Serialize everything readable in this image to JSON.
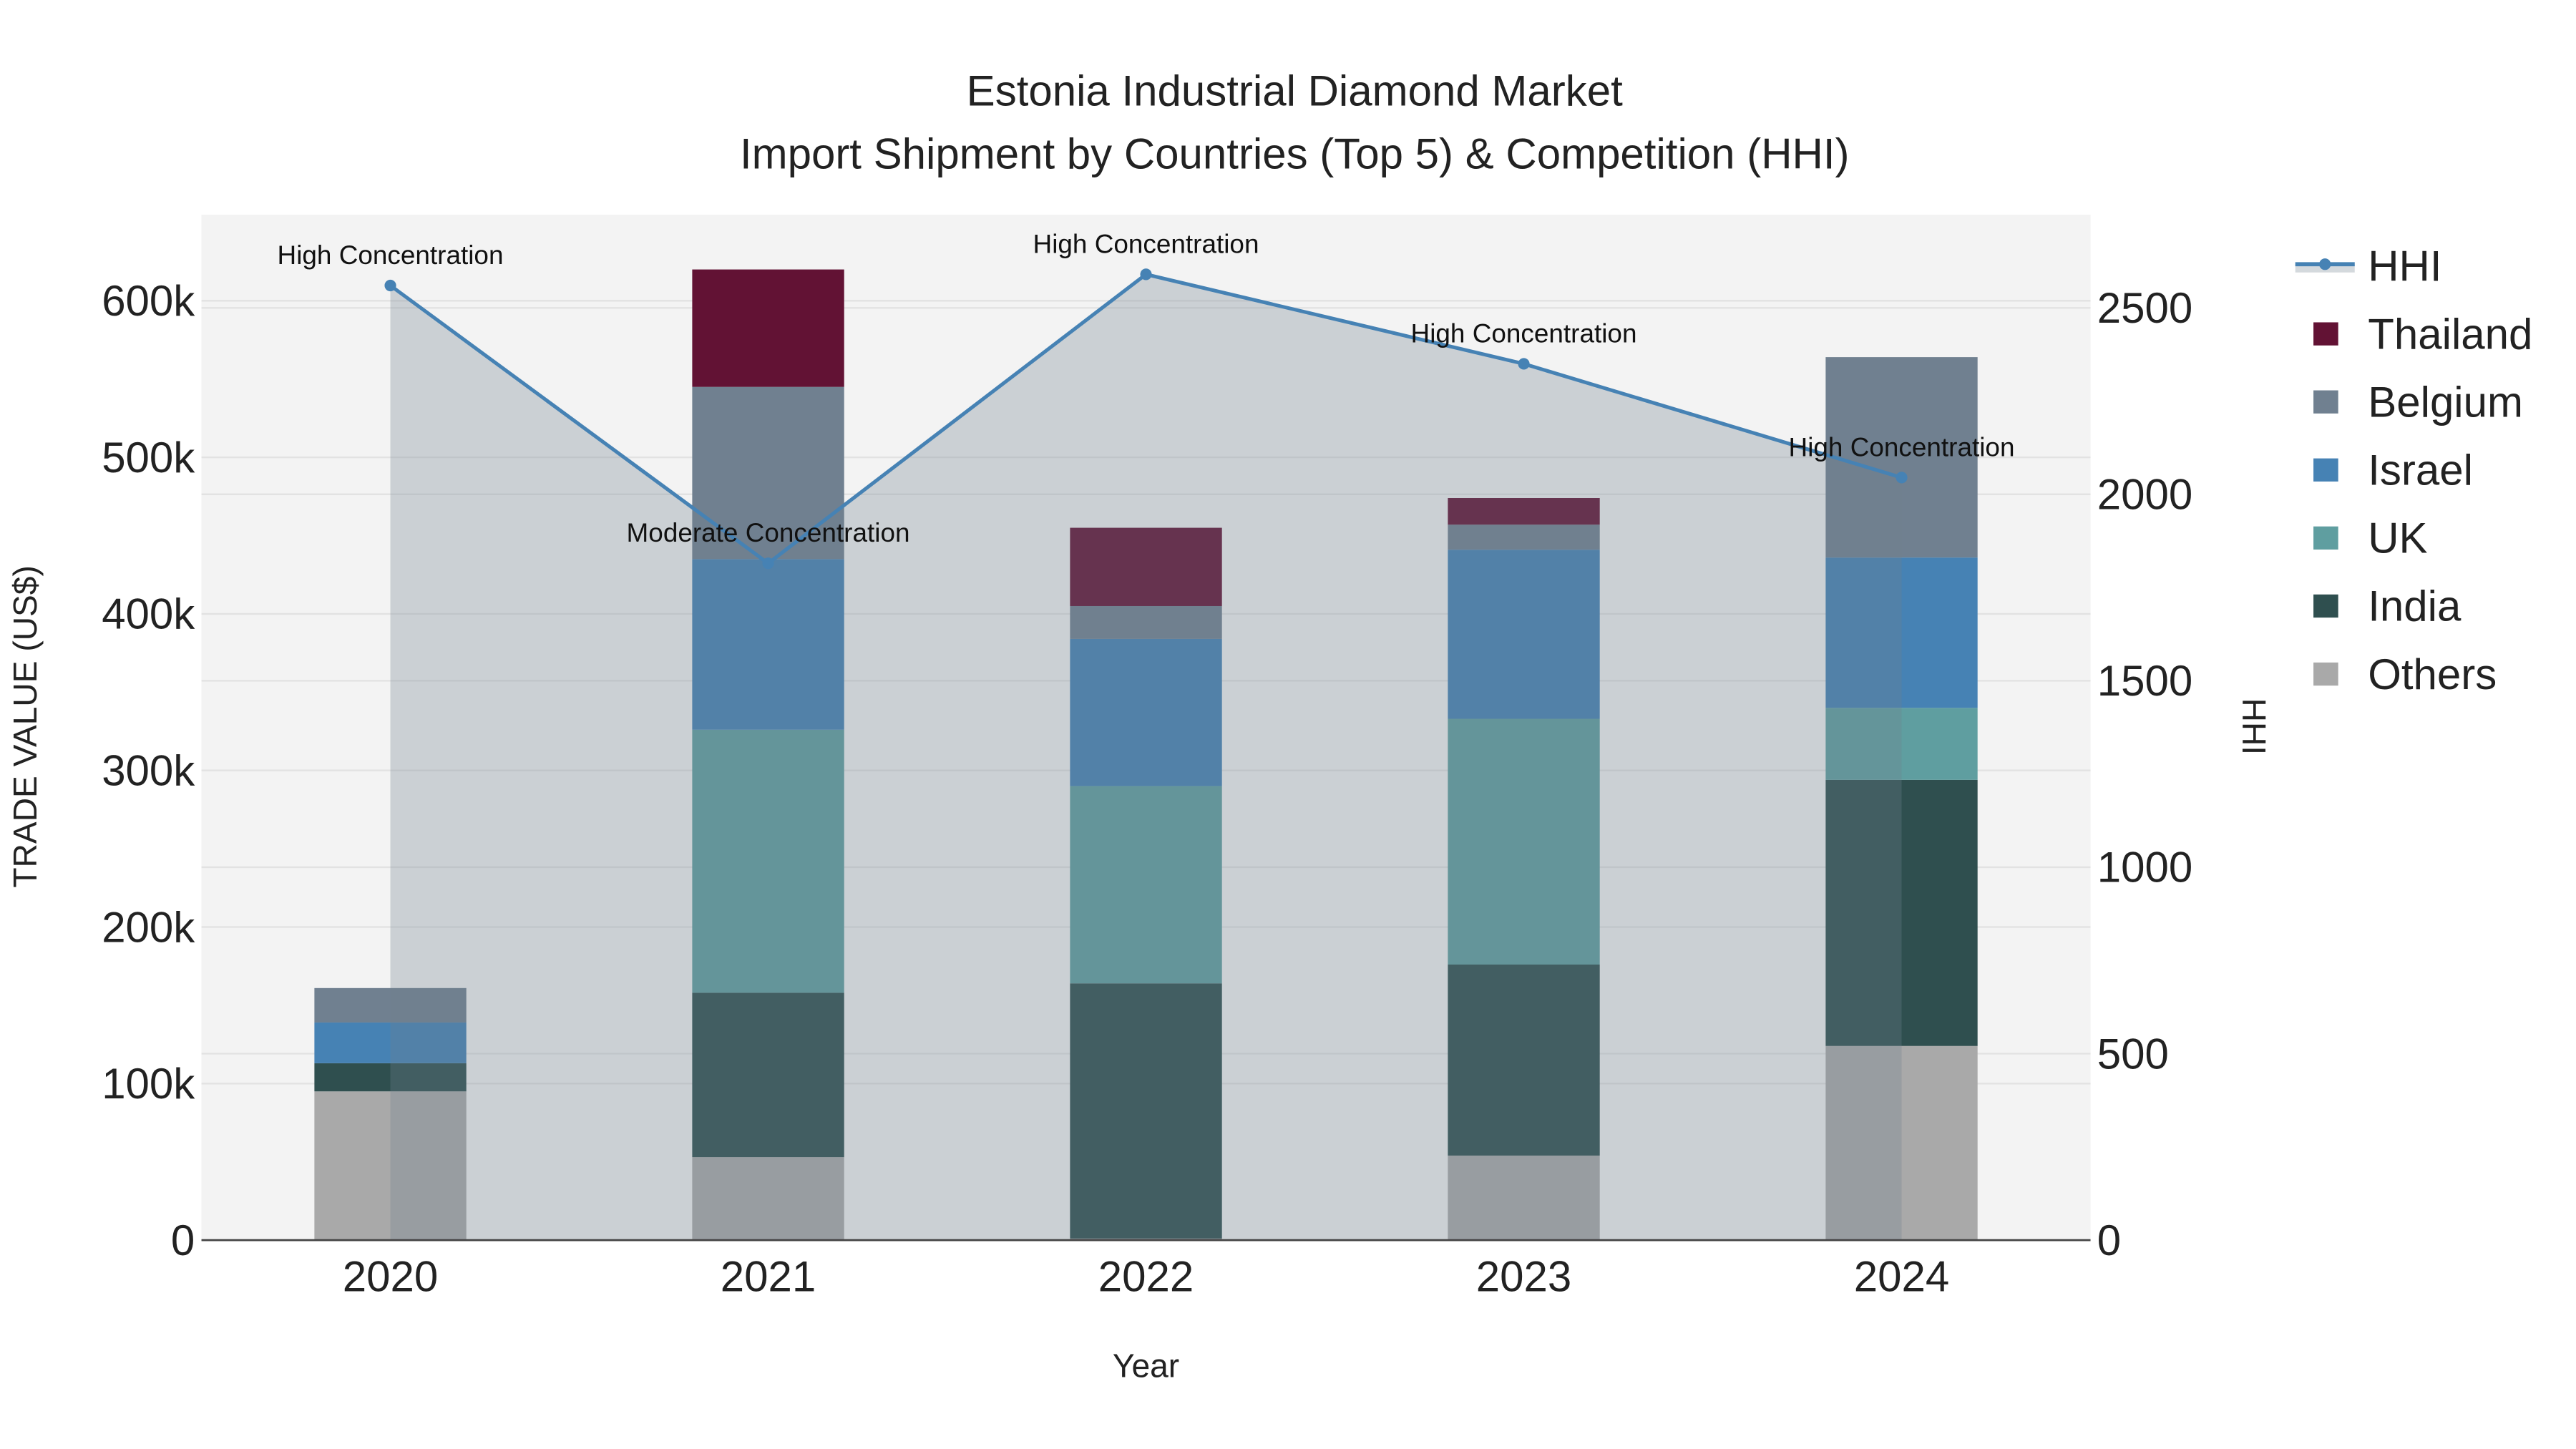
{
  "chart_data": {
    "type": "bar",
    "stacked": true,
    "title": "Estonia Industrial Diamond Market",
    "subtitle": "Import Shipment by Countries (Top 5) & Competition (HHI)",
    "xlabel": "Year",
    "ylabel": "TRADE VALUE (US$)",
    "y2label": "HHI",
    "categories": [
      "2020",
      "2021",
      "2022",
      "2023",
      "2024"
    ],
    "ylim": [
      0,
      655000
    ],
    "y2lim": [
      0,
      2750
    ],
    "yticks": [
      0,
      100000,
      200000,
      300000,
      400000,
      500000,
      600000
    ],
    "ytick_labels": [
      "0",
      "100k",
      "200k",
      "300k",
      "400k",
      "500k",
      "600k"
    ],
    "y2ticks": [
      0,
      500,
      1000,
      1500,
      2000,
      2500
    ],
    "y2tick_labels": [
      "0",
      "500",
      "1000",
      "1500",
      "2000",
      "2500"
    ],
    "series": [
      {
        "name": "Others",
        "color": "#A9A9A9",
        "values": [
          95000,
          53000,
          1000,
          54000,
          124000
        ]
      },
      {
        "name": "India",
        "color": "#2F4F4F",
        "values": [
          18000,
          105000,
          163000,
          122000,
          170000
        ]
      },
      {
        "name": "UK",
        "color": "#5F9EA0",
        "values": [
          0,
          168000,
          126000,
          157000,
          46000
        ]
      },
      {
        "name": "Israel",
        "color": "#4682B4",
        "values": [
          26000,
          109000,
          94000,
          108000,
          96000
        ]
      },
      {
        "name": "Belgium",
        "color": "#708090",
        "values": [
          22000,
          110000,
          21000,
          16000,
          128000
        ]
      },
      {
        "name": "Thailand",
        "color": "#621234",
        "values": [
          0,
          75000,
          50000,
          17000,
          0
        ]
      }
    ],
    "legend_order": [
      "HHI",
      "Thailand",
      "Belgium",
      "Israel",
      "UK",
      "India",
      "Others"
    ],
    "hhi": {
      "name": "HHI",
      "color": "#4682B4",
      "values": [
        2560,
        1815,
        2590,
        2350,
        2045
      ],
      "annotations": [
        "High Concentration",
        "Moderate Concentration",
        "High Concentration",
        "High Concentration",
        "High Concentration"
      ]
    },
    "legend_position": "top-right",
    "grid": true
  }
}
